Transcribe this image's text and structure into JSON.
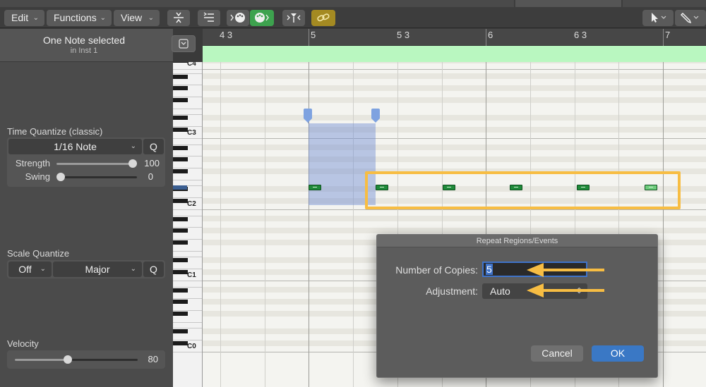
{
  "toolbar": {
    "edit_label": "Edit",
    "functions_label": "Functions",
    "view_label": "View",
    "colors": {
      "link_active": "#a48a22",
      "midi_in": "#3da24e"
    }
  },
  "inspector": {
    "selection_title": "One Note selected",
    "selection_subtitle": "in Inst 1",
    "time_quantize": {
      "title": "Time Quantize (classic)",
      "value": "1/16 Note",
      "q_label": "Q",
      "strength_label": "Strength",
      "strength_value": "100",
      "strength_level": 1.0,
      "swing_label": "Swing",
      "swing_value": "0",
      "swing_level": 0.0
    },
    "scale_quantize": {
      "title": "Scale Quantize",
      "root": "Off",
      "scale": "Major",
      "q_label": "Q"
    },
    "velocity": {
      "title": "Velocity",
      "value": "80",
      "level": 0.43
    }
  },
  "ruler": {
    "labels": [
      "4 3",
      "5",
      "5 3",
      "6",
      "6 3",
      "7"
    ]
  },
  "keyboard": {
    "octaves": [
      "C4",
      "C3",
      "C2",
      "C1",
      "C0"
    ]
  },
  "dialog": {
    "title": "Repeat Regions/Events",
    "copies_label": "Number of Copies:",
    "copies_value": "5",
    "adjustment_label": "Adjustment:",
    "adjustment_value": "Auto",
    "cancel_label": "Cancel",
    "ok_label": "OK"
  },
  "annotations": {
    "highlight_color": "#f7bd43",
    "arrow_color": "#f7bd43"
  }
}
